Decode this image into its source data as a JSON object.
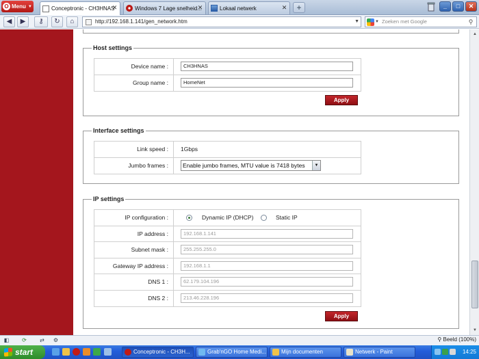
{
  "browser": {
    "menu_label": "Menu",
    "tabs": [
      {
        "title": "Conceptronic - CH3HNAS"
      },
      {
        "title": "Windows 7 Lage snelheid..."
      },
      {
        "title": "Lokaal netwerk"
      }
    ],
    "url": "http://192.168.1.141/gen_network.htm",
    "search_placeholder": "Zoeken met Google"
  },
  "host_settings": {
    "legend": "Host settings",
    "device_name_label": "Device name :",
    "device_name_value": "CH3HNAS",
    "group_name_label": "Group name :",
    "group_name_value": "HomeNet",
    "apply_label": "Apply"
  },
  "interface_settings": {
    "legend": "Interface settings",
    "link_speed_label": "Link speed :",
    "link_speed_value": "1Gbps",
    "jumbo_frames_label": "Jumbo frames :",
    "jumbo_frames_value": "Enable jumbo frames, MTU value is 7418 bytes"
  },
  "ip_settings": {
    "legend": "IP settings",
    "ip_config_label": "IP configuration :",
    "option_dhcp": "Dynamic IP (DHCP)",
    "option_static": "Static IP",
    "selected": "Dynamic IP (DHCP)",
    "ip_address_label": "IP address :",
    "ip_address_value": "192.168.1.141",
    "subnet_mask_label": "Subnet mask :",
    "subnet_mask_value": "255.255.255.0",
    "gateway_label": "Gateway IP address :",
    "gateway_value": "192.168.1.1",
    "dns1_label": "DNS 1 :",
    "dns1_value": "62.179.104.196",
    "dns2_label": "DNS 2 :",
    "dns2_value": "213.46.228.196",
    "apply_label": "Apply"
  },
  "statusbar": {
    "zoom": "Beeld (100%)"
  },
  "taskbar": {
    "start_label": "start",
    "items": [
      {
        "label": "Conceptronic - CH3H..."
      },
      {
        "label": "Grab'nGO Home Medi..."
      },
      {
        "label": "Mijn documenten"
      },
      {
        "label": "Netwerk - Paint"
      }
    ],
    "clock": "14:25"
  },
  "colors": {
    "sidebar_red": "#a4161d",
    "apply_red": "#b01b20",
    "taskbar_blue": "#245edb",
    "start_green": "#3a9a36"
  }
}
